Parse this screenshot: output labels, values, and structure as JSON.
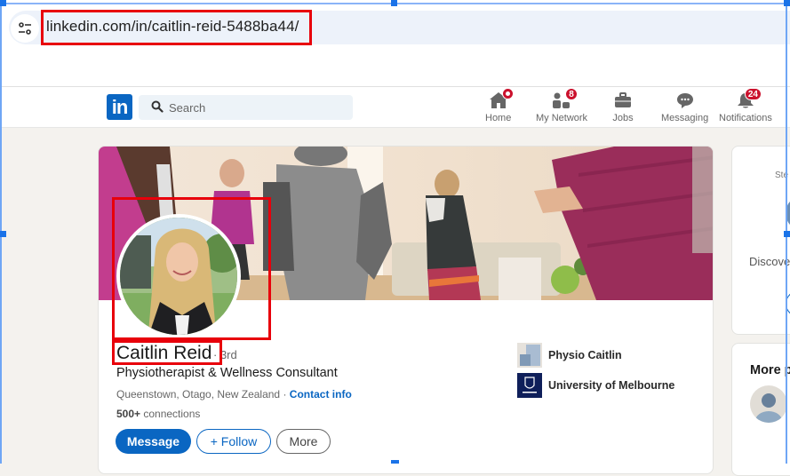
{
  "browser": {
    "url": "linkedin.com/in/caitlin-reid-5488ba44/",
    "site_icon": "tune-icon"
  },
  "nav": {
    "search_placeholder": "Search",
    "items": [
      {
        "label": "Home",
        "icon": "home-icon",
        "badge": "dot"
      },
      {
        "label": "My Network",
        "icon": "network-icon",
        "badge": "8"
      },
      {
        "label": "Jobs",
        "icon": "briefcase-icon",
        "badge": ""
      },
      {
        "label": "Messaging",
        "icon": "chat-icon",
        "badge": ""
      },
      {
        "label": "Notifications",
        "icon": "bell-icon",
        "badge": "24"
      }
    ]
  },
  "profile": {
    "name": "Caitlin Reid",
    "degree": "· 3rd",
    "headline": "Physiotherapist & Wellness Consultant",
    "location": "Queenstown, Otago, New Zealand",
    "location_sep": " · ",
    "contact_label": "Contact info",
    "connections_count": "500+",
    "connections_label": " connections",
    "buttons": {
      "message": "Message",
      "follow": "+ Follow",
      "more": "More"
    },
    "orgs": [
      {
        "name": "Physio Caitlin"
      },
      {
        "name": "University of Melbourne"
      }
    ]
  },
  "sidebar": {
    "card1_small": "Ste",
    "card1_text": "Discove",
    "card2_title": "More p"
  },
  "colors": {
    "brand": "#0a66c2",
    "badge": "#cb112d",
    "highlight": "#e8000b"
  }
}
